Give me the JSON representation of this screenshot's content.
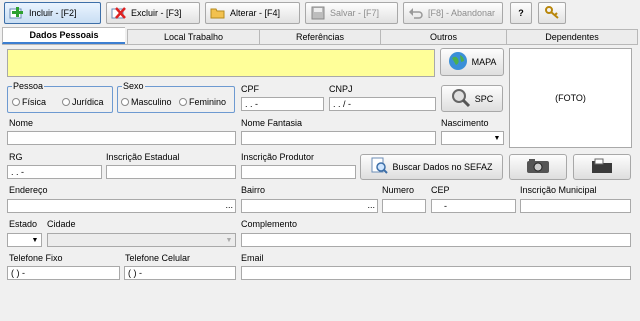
{
  "toolbar": {
    "incluir": "Incluir - [F2]",
    "excluir": "Excluir - [F3]",
    "alterar": "Alterar - [F4]",
    "salvar": "Salvar - [F7]",
    "abandonar": "[F8] - Abandonar",
    "help": "?",
    "icons": {
      "incluir": "add-icon",
      "excluir": "delete-icon",
      "alterar": "folder-edit-icon",
      "salvar": "save-icon",
      "abandonar": "undo-icon",
      "keys": "keys-icon"
    }
  },
  "tabs": [
    "Dados Pessoais",
    "Local Trabalho",
    "Referências",
    "Outros",
    "Dependentes"
  ],
  "form": {
    "mapa_label": "MAPA",
    "spc_label": "SPC",
    "foto_label": "(FOTO)",
    "pessoa": {
      "title": "Pessoa",
      "opt1": "Física",
      "opt2": "Jurídica"
    },
    "sexo": {
      "title": "Sexo",
      "opt1": "Masculino",
      "opt2": "Feminino"
    },
    "cpf_label": "CPF",
    "cpf_value": " .  .  -",
    "cnpj_label": "CNPJ",
    "cnpj_value": " .  .  /  -",
    "nome_label": "Nome",
    "nome_fantasia_label": "Nome Fantasia",
    "nascimento_label": "Nascimento",
    "rg_label": "RG",
    "rg_value": " .  .  -",
    "inscricao_estadual_label": "Inscrição Estadual",
    "inscricao_produtor_label": "Inscrição Produtor",
    "sefaz_label": "Buscar Dados no SEFAZ",
    "endereco_label": "Endereço",
    "bairro_label": "Bairro",
    "numero_label": "Numero",
    "cep_label": "CEP",
    "cep_value": "-",
    "inscricao_municipal_label": "Inscrição Municipal",
    "ellipsis": "...",
    "estado_label": "Estado",
    "cidade_label": "Cidade",
    "complemento_label": "Complemento",
    "telefone_fixo_label": "Telefone Fixo",
    "telefone_fixo_value": "(  )    -",
    "telefone_celular_label": "Telefone Celular",
    "telefone_celular_value": "(  )    -",
    "email_label": "Email"
  },
  "colors": {
    "highlight": "#ffff99",
    "accent": "#3c7fd1",
    "group_border": "#6d9ad1"
  }
}
